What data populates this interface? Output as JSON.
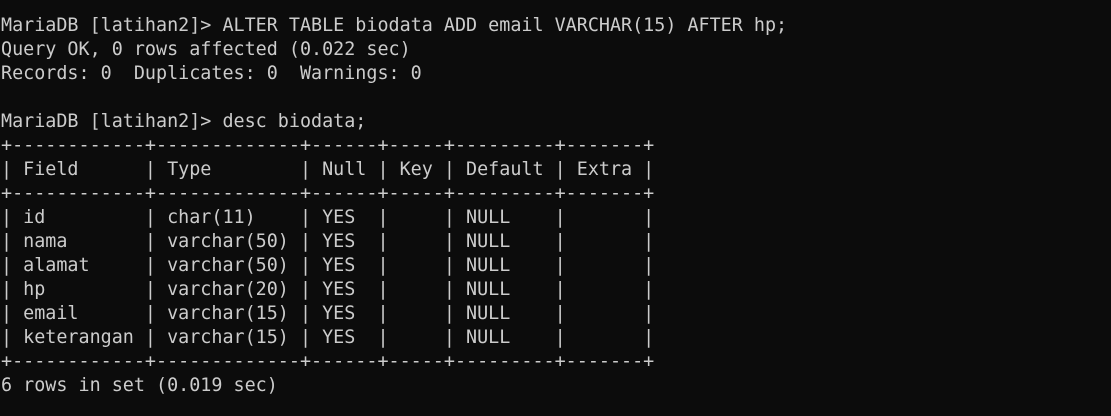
{
  "terminal": {
    "lines": [
      "MariaDB [latihan2]> ALTER TABLE biodata ADD email VARCHAR(15) AFTER hp;",
      "Query OK, 0 rows affected (0.022 sec)",
      "Records: 0  Duplicates: 0  Warnings: 0",
      "",
      "MariaDB [latihan2]> desc biodata;",
      "+------------+-------------+------+-----+---------+-------+",
      "| Field      | Type        | Null | Key | Default | Extra |",
      "+------------+-------------+------+-----+---------+-------+",
      "| id         | char(11)    | YES  |     | NULL    |       |",
      "| nama       | varchar(50) | YES  |     | NULL    |       |",
      "| alamat     | varchar(50) | YES  |     | NULL    |       |",
      "| hp         | varchar(20) | YES  |     | NULL    |       |",
      "| email      | varchar(15) | YES  |     | NULL    |       |",
      "| keterangan | varchar(15) | YES  |     | NULL    |       |",
      "+------------+-------------+------+-----+---------+-------+",
      "6 rows in set (0.019 sec)"
    ]
  },
  "colors": {
    "background": "#0c0c0c",
    "text": "#cccccc"
  }
}
